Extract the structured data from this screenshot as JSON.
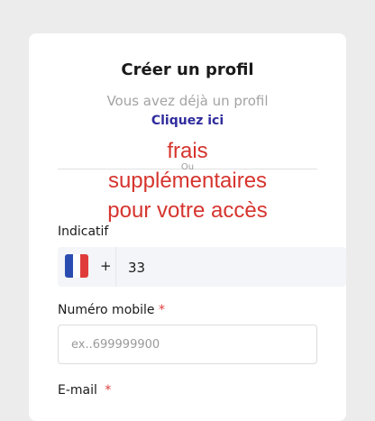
{
  "form": {
    "title": "Créer un profil",
    "subtitle": "Vous avez déjà un profil",
    "login_link": "Cliquez ici",
    "or_text": "Ou",
    "overlay_lines": [
      "frais",
      "supplémentaires",
      "pour votre accès"
    ],
    "country_code_label": "Indicatif",
    "plus_sign": "+",
    "country_code_value": "33",
    "mobile_label": "Numéro mobile",
    "mobile_placeholder": "ex..699999900",
    "email_label": "E-mail",
    "required_mark": "*"
  },
  "colors": {
    "accent_link": "#2f2b9c",
    "overlay_red": "#d6342e",
    "required_red": "#e03b3b"
  }
}
